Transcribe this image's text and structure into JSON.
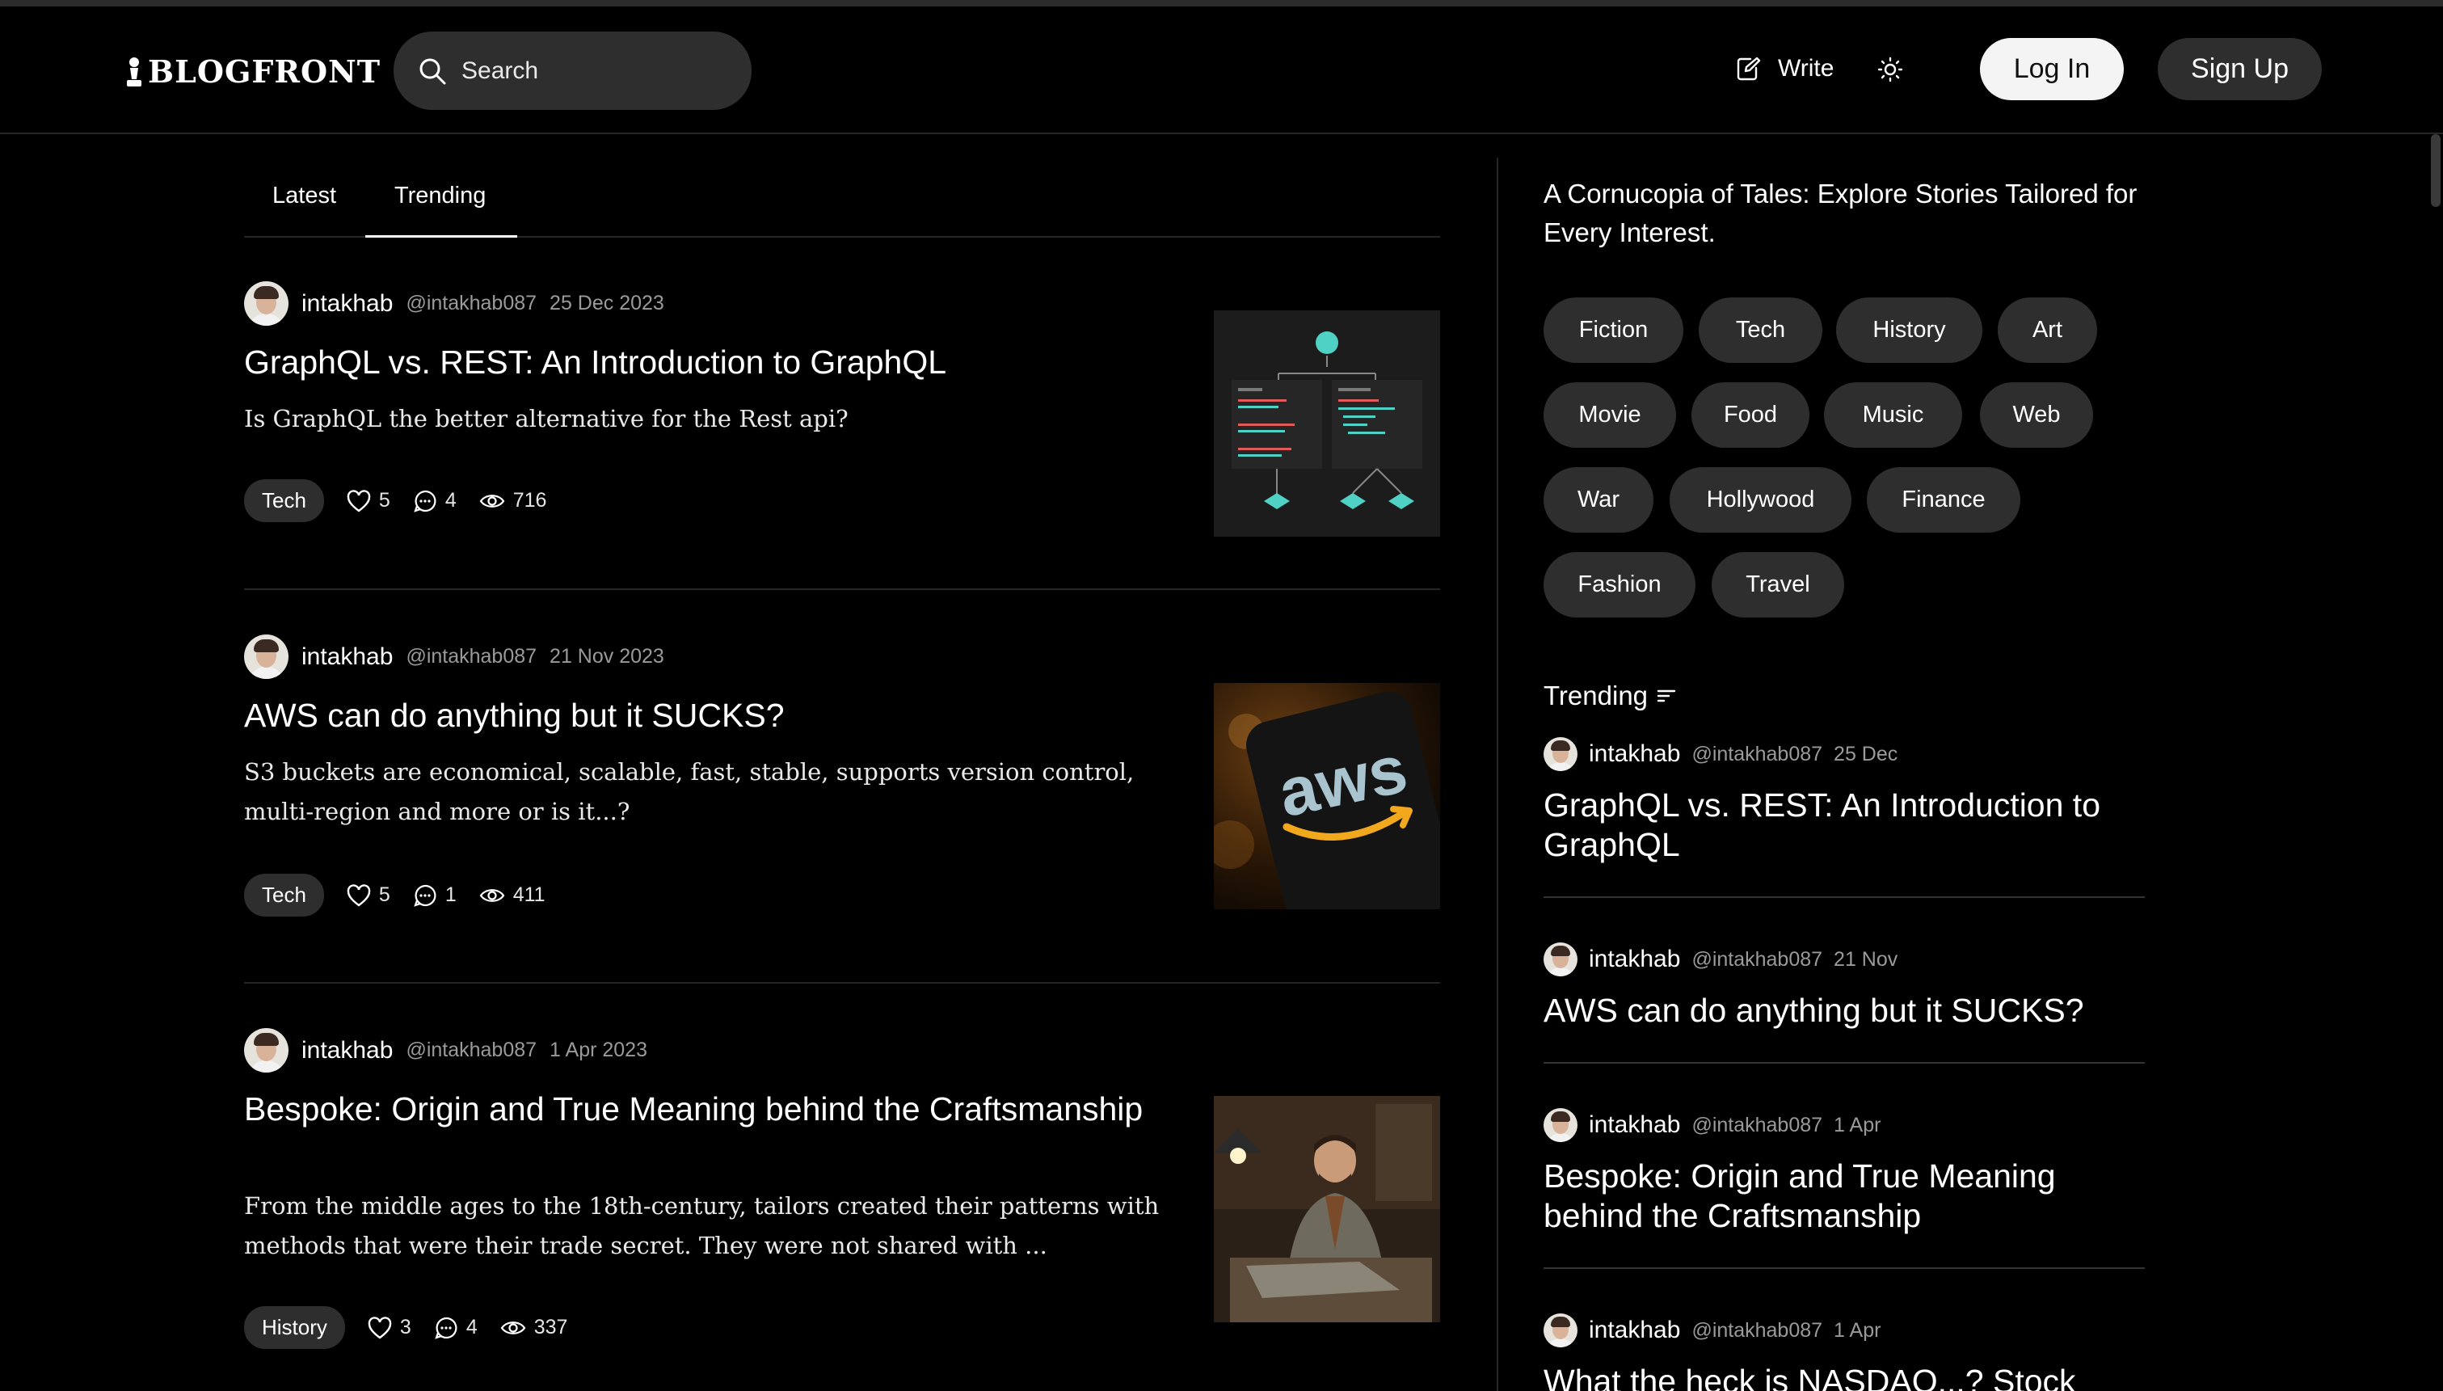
{
  "header": {
    "logo": "BLOGFRONT",
    "search_placeholder": "Search",
    "write_label": "Write",
    "login_label": "Log In",
    "signup_label": "Sign Up"
  },
  "tabs": [
    "Latest",
    "Trending"
  ],
  "articles": [
    {
      "author": "intakhab",
      "handle": "@intakhab087",
      "date": "25 Dec 2023",
      "title": "GraphQL vs. REST: An Introduction to GraphQL",
      "subtitle": "Is GraphQL the better alternative for the Rest api?",
      "tag": "Tech",
      "likes": "5",
      "comments": "4",
      "views": "716"
    },
    {
      "author": "intakhab",
      "handle": "@intakhab087",
      "date": "21 Nov 2023",
      "title": "AWS can do anything but it SUCKS?",
      "subtitle": "S3 buckets are economical, scalable, fast, stable, supports version control, multi-region and more or is it...?",
      "tag": "Tech",
      "likes": "5",
      "comments": "1",
      "views": "411",
      "thumb_text": "aws"
    },
    {
      "author": "intakhab",
      "handle": "@intakhab087",
      "date": "1 Apr 2023",
      "title": "Bespoke: Origin and True Meaning behind the Craftsmanship",
      "subtitle": "From the middle ages to the 18th-century, tailors created their patterns with methods that were their trade secret. They were not shared with ...",
      "tag": "History",
      "likes": "3",
      "comments": "4",
      "views": "337"
    }
  ],
  "sidebar": {
    "heading": "A Cornucopia of Tales: Explore Stories Tailored for Every Interest.",
    "categories": [
      "Fiction",
      "Tech",
      "History",
      "Art",
      "Movie",
      "Food",
      "Music",
      "Web",
      "War",
      "Hollywood",
      "Finance",
      "Fashion",
      "Travel"
    ],
    "trending_label": "Trending",
    "trending": [
      {
        "author": "intakhab",
        "handle": "@intakhab087",
        "date": "25 Dec",
        "title": "GraphQL vs. REST: An Introduction to GraphQL"
      },
      {
        "author": "intakhab",
        "handle": "@intakhab087",
        "date": "21 Nov",
        "title": "AWS can do anything but it SUCKS?"
      },
      {
        "author": "intakhab",
        "handle": "@intakhab087",
        "date": "1 Apr",
        "title": "Bespoke: Origin and True Meaning behind the Craftsmanship"
      },
      {
        "author": "intakhab",
        "handle": "@intakhab087",
        "date": "1 Apr",
        "title": "What the heck is NASDAQ...? Stock"
      }
    ]
  },
  "colors": {
    "background": "#000000",
    "pill": "#2e2e2e",
    "muted_text": "#9a9a9a",
    "divider": "#262626",
    "login_bg": "#f4f4f4"
  },
  "icons": {
    "logo": "chess-pawn-icon",
    "search": "search-icon",
    "write": "write-icon",
    "theme": "sun-icon",
    "like": "heart-icon",
    "comment": "comment-icon",
    "views": "eye-icon",
    "trending": "sort-icon"
  }
}
